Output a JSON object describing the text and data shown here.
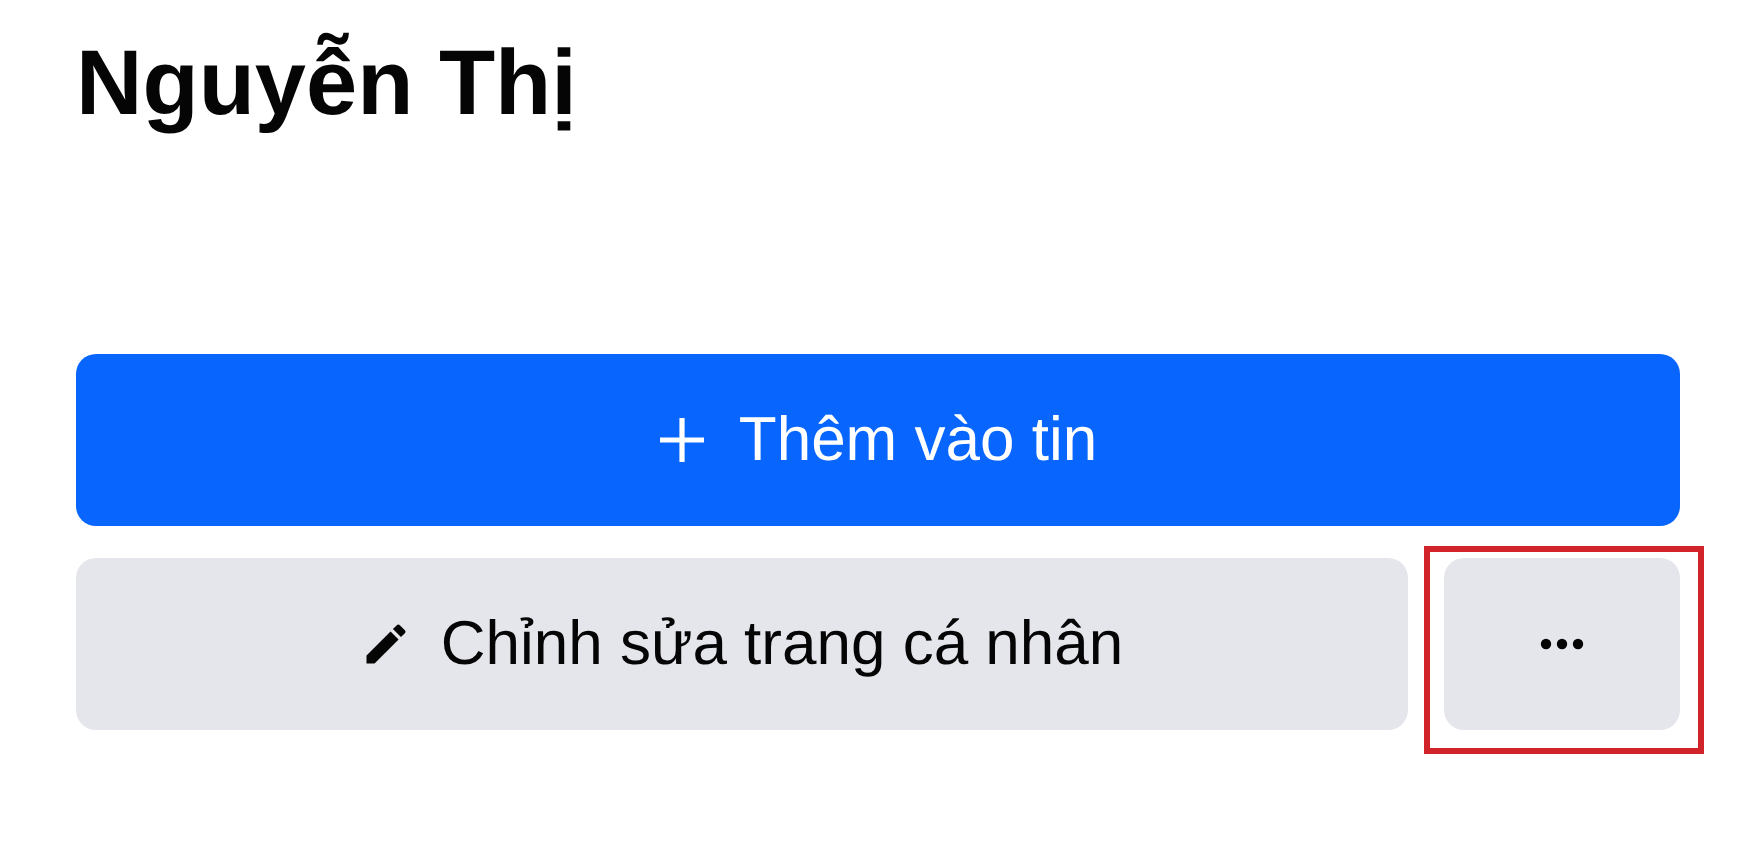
{
  "profile_name": "Nguyễn Thị",
  "add_story_button": {
    "label": "Thêm vào tin"
  },
  "edit_profile_button": {
    "label": "Chỉnh sửa trang cá nhân"
  },
  "more_button": {
    "highlighted": true
  }
}
